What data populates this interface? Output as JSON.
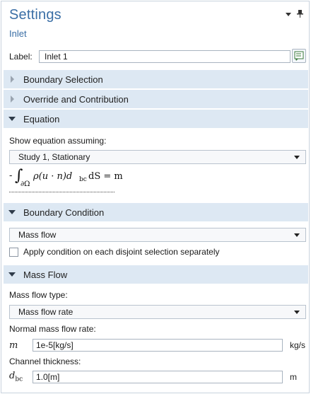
{
  "header": {
    "title": "Settings",
    "subtitle": "Inlet",
    "menu_icon": "dropdown-arrow-icon",
    "pin_icon": "pin-icon"
  },
  "label_row": {
    "label": "Label:",
    "value": "Inlet 1",
    "button_icon": "edit-label-icon"
  },
  "sections": {
    "boundary_selection": "Boundary Selection",
    "override": "Override and Contribution",
    "equation": "Equation",
    "boundary_condition": "Boundary Condition",
    "mass_flow": "Mass Flow"
  },
  "equation": {
    "show_label": "Show equation assuming:",
    "study_value": "Study 1, Stationary",
    "formula_prefix": "-",
    "formula_integral": "∫",
    "formula_domain": "∂Ω",
    "formula_body": "ρ(u · n)d",
    "formula_sub": "bc",
    "formula_tail": "dS = m"
  },
  "boundary_condition": {
    "value": "Mass flow",
    "checkbox_label": "Apply condition on each disjoint selection separately",
    "checkbox_checked": false
  },
  "mass_flow": {
    "type_label": "Mass flow type:",
    "type_value": "Mass flow rate",
    "rate_label": "Normal mass flow rate:",
    "rate_symbol": "m",
    "rate_value": "1e-5[kg/s]",
    "rate_unit": "kg/s",
    "thickness_label": "Channel thickness:",
    "thickness_symbol": "d",
    "thickness_sub": "bc",
    "thickness_value": "1.0[m]",
    "thickness_unit": "m"
  },
  "colors": {
    "title": "#3a6ea5",
    "section_bg": "#dde8f3"
  }
}
